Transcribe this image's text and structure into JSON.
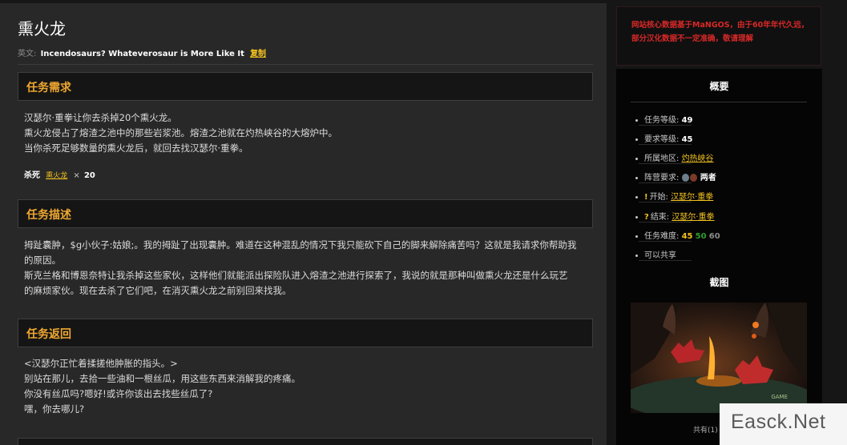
{
  "quest": {
    "title": "熏火龙",
    "en_label": "英文:",
    "en_title": "Incendosaurs? Whateverosaur is More Like It",
    "copy_label": "复制"
  },
  "sections": {
    "requirements": {
      "heading": "任务需求",
      "lines": [
        "汉瑟尔·重拳让你去杀掉20个熏火龙。",
        "熏火龙侵占了熔渣之池中的那些岩浆池。熔渣之池就在灼热峡谷的大熔炉中。",
        "当你杀死足够数量的熏火龙后，就回去找汉瑟尔·重拳。"
      ],
      "kill_label": "杀死",
      "kill_target": "熏火龙",
      "kill_times": "×",
      "kill_count": "20"
    },
    "description": {
      "heading": "任务描述",
      "lines": [
        "拇趾囊肿，$g小伙子:姑娘;。我的拇趾了出现囊肿。难道在这种混乱的情况下我只能砍下自己的脚来解除痛苦吗？这就是我请求你帮助我",
        "的原因。",
        "斯克兰格和博恩奈特让我杀掉这些家伙，这样他们就能派出探险队进入熔渣之池进行探索了，我说的就是那种叫做熏火龙还是什么玩艺",
        "的麻烦家伙。现在去杀了它们吧，在消灭熏火龙之前别回来找我。"
      ]
    },
    "return": {
      "heading": "任务返回",
      "lines": [
        "<汉瑟尔正忙着揉搓他肿胀的指头。>",
        "别站在那儿，去拾一些油和一根丝瓜，用这些东西来消解我的疼痛。",
        "你没有丝瓜吗?嗯好!或许你该出去找些丝瓜了?",
        "嘿，你去哪儿?"
      ]
    }
  },
  "notice": {
    "text": "网站核心数据基于MaNGOS，由于60年年代久远，部分汉化数据不一定准确，敬请理解"
  },
  "sidebar": {
    "overview_title": "概要",
    "level_label": "任务等级:",
    "level_value": "49",
    "req_level_label": "要求等级:",
    "req_level_value": "45",
    "zone_label": "所属地区:",
    "zone_value": "灼热峡谷",
    "faction_label": "阵营要求:",
    "faction_value": "两者",
    "start_mark": "!",
    "start_label": "开始:",
    "start_value": "汉瑟尔·重拳",
    "end_mark": "?",
    "end_label": "结束:",
    "end_value": "汉瑟尔·重拳",
    "difficulty_label": "任务难度:",
    "difficulty_values": [
      "45",
      "50",
      "60"
    ],
    "shareable": "可以共享",
    "screenshot_title": "截图",
    "screenshot_count": "共有(1)"
  },
  "watermark": {
    "text": "Easck.Net"
  },
  "colors": {
    "accent_heading": "#f0a830",
    "link": "#f0c020",
    "notice_red": "#d82828",
    "difficulty_green": "#2e9e2e",
    "difficulty_grey": "#8a8a8a"
  }
}
